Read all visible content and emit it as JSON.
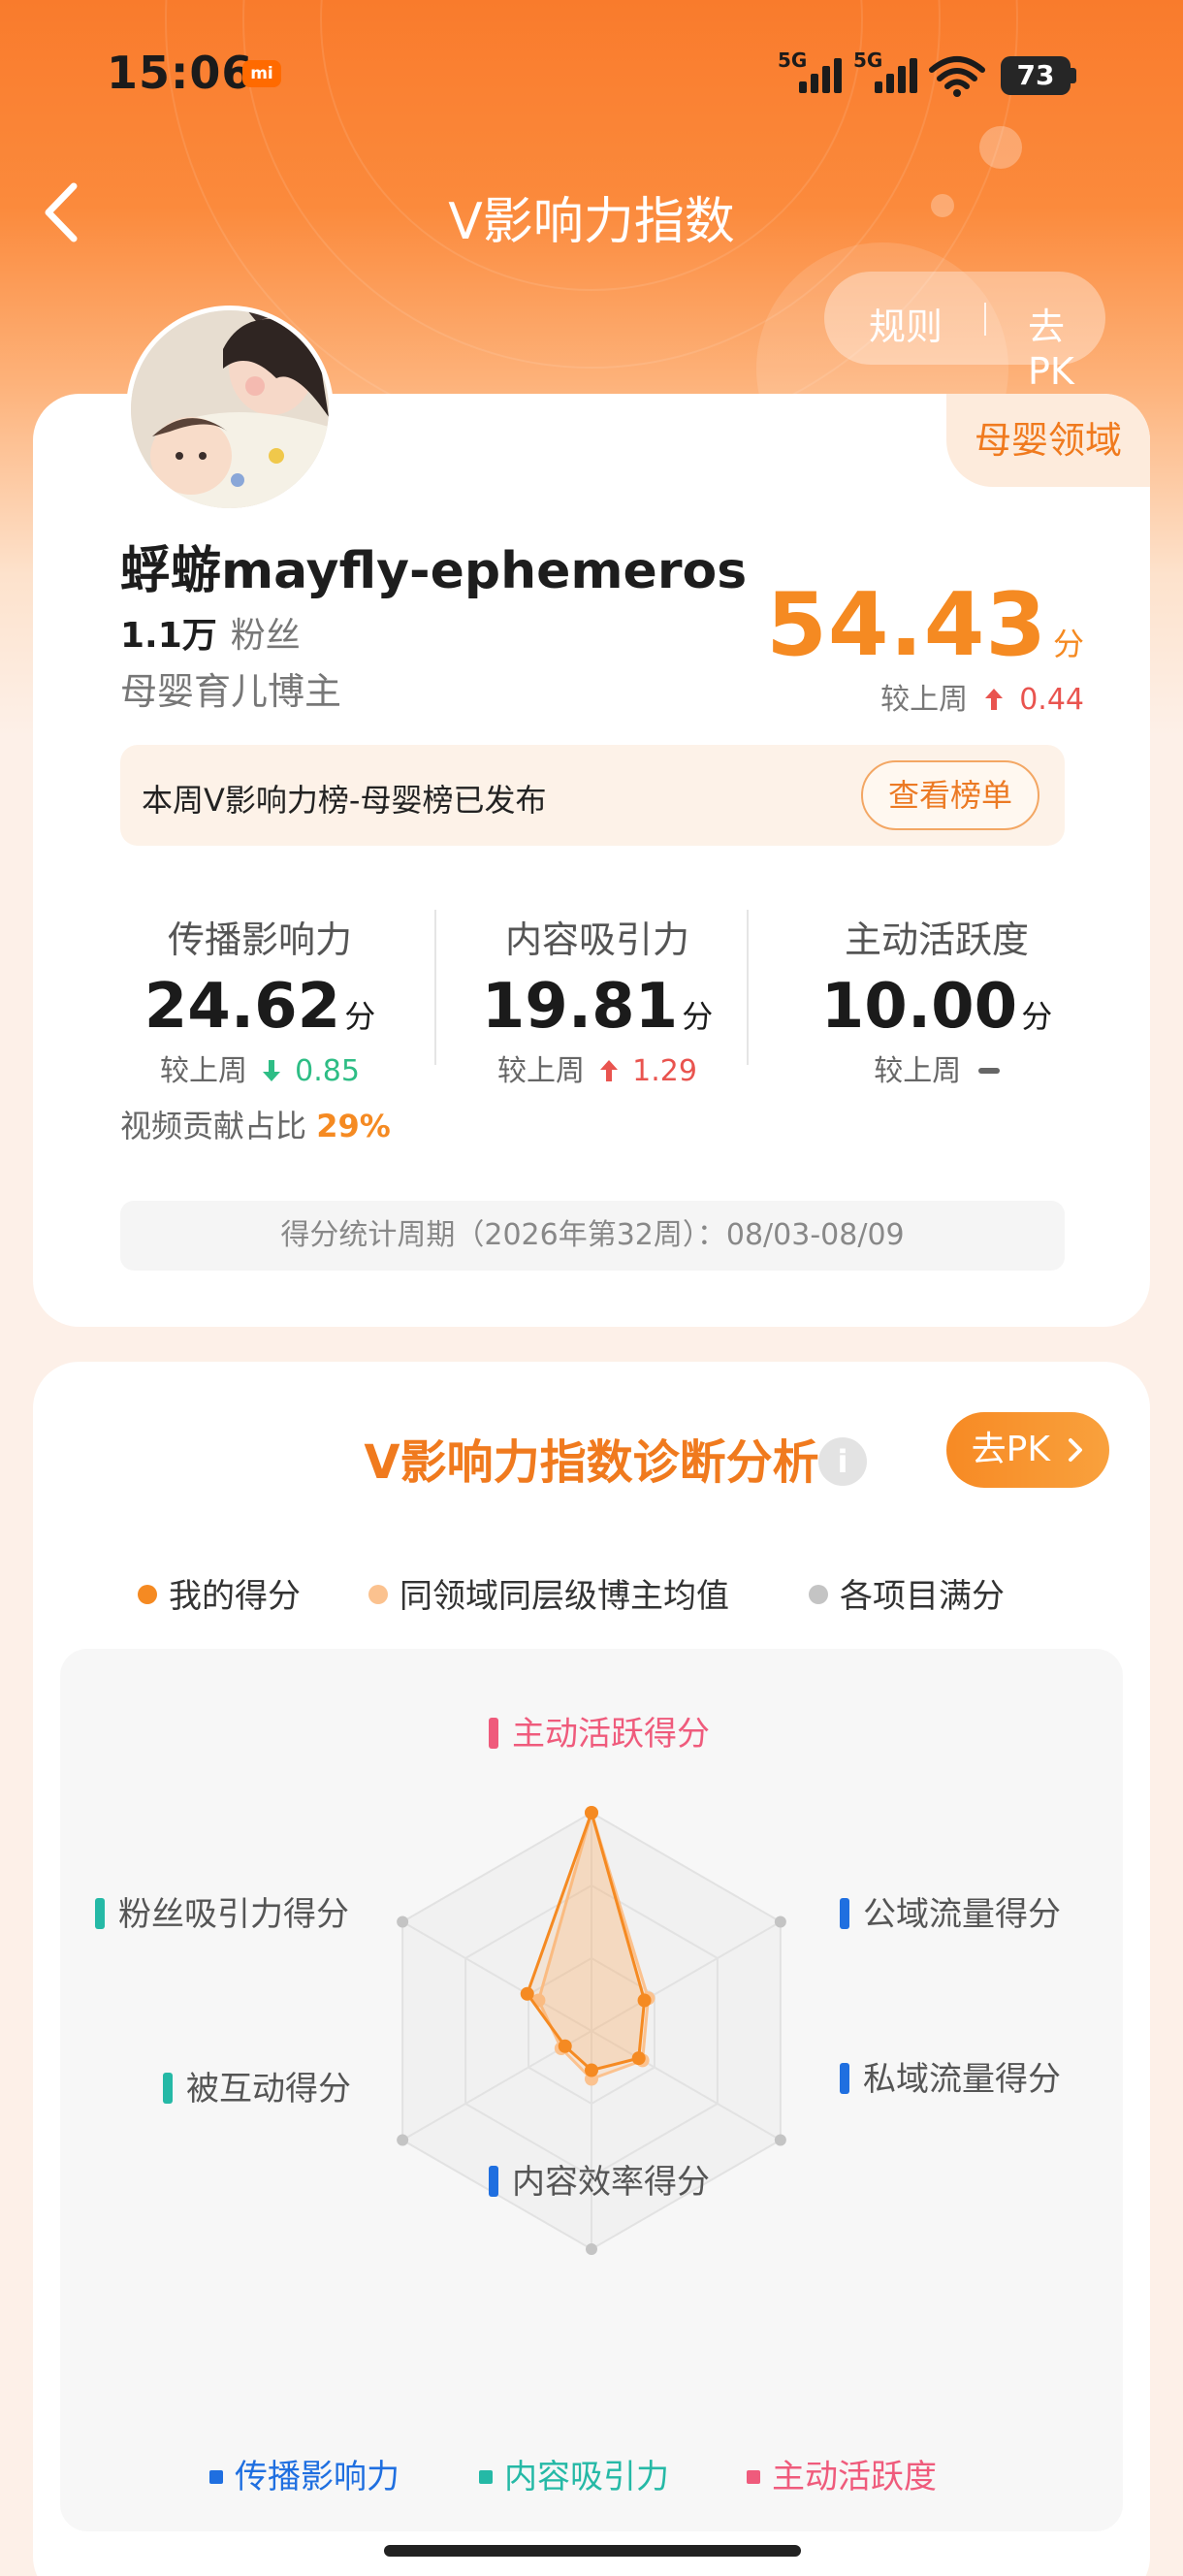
{
  "status_bar": {
    "time": "15:06",
    "mi_badge": "mi",
    "signal1": "5G",
    "signal2": "5G",
    "battery": "73"
  },
  "nav": {
    "title": "V影响力指数",
    "rules": "规则",
    "pk": "去PK"
  },
  "profile": {
    "domain_tag": "母婴领域",
    "name": "蜉蝣mayfly-ephemeros",
    "fans_count": "1.1万",
    "fans_label": "粉丝",
    "role": "母婴育儿博主",
    "score": "54.43",
    "score_unit": "分",
    "compare_label": "较上周",
    "score_delta": "0.44",
    "notice": "本周V影响力榜-母婴榜已发布",
    "notice_button": "查看榜单",
    "metrics": [
      {
        "label": "传播影响力",
        "value": "24.62",
        "unit": "分",
        "compare": "较上周",
        "delta": "0.85",
        "trend": "down"
      },
      {
        "label": "内容吸引力",
        "value": "19.81",
        "unit": "分",
        "compare": "较上周",
        "delta": "1.29",
        "trend": "up"
      },
      {
        "label": "主动活跃度",
        "value": "10.00",
        "unit": "分",
        "compare": "较上周",
        "delta": "",
        "trend": "flat"
      }
    ],
    "video_share_label": "视频贡献占比",
    "video_share": "29%",
    "period": "得分统计周期（2026年第32周）：08/03-08/09"
  },
  "analysis": {
    "title": "V影响力指数诊断分析",
    "info_icon": "i",
    "pk_button": "去PK",
    "legend": [
      "我的得分",
      "同领域同层级博主均值",
      "各项目满分"
    ],
    "bottom_legend": [
      "传播影响力",
      "内容吸引力",
      "主动活跃度"
    ],
    "colors": {
      "mine": "#f58a22",
      "avg": "#fbc28f",
      "full": "#c4c4c4",
      "blue": "#1f6fe0",
      "teal": "#25b9a6",
      "pink": "#ef5b7c"
    }
  },
  "chart_data": {
    "type": "radar",
    "axes": [
      "主动活跃得分",
      "公域流量得分",
      "私域流量得分",
      "内容效率得分",
      "被互动得分",
      "粉丝吸引力得分"
    ],
    "axis_groups": [
      "主动活跃度",
      "传播影响力",
      "传播影响力",
      "传播影响力",
      "内容吸引力",
      "内容吸引力"
    ],
    "max": 1,
    "series": [
      {
        "name": "我的得分",
        "values": [
          1.0,
          0.28,
          0.25,
          0.18,
          0.14,
          0.34
        ]
      },
      {
        "name": "同领域同层级博主均值",
        "values": [
          1.0,
          0.3,
          0.27,
          0.22,
          0.16,
          0.28
        ]
      },
      {
        "name": "各项目满分",
        "values": [
          1,
          1,
          1,
          1,
          1,
          1
        ]
      }
    ]
  }
}
